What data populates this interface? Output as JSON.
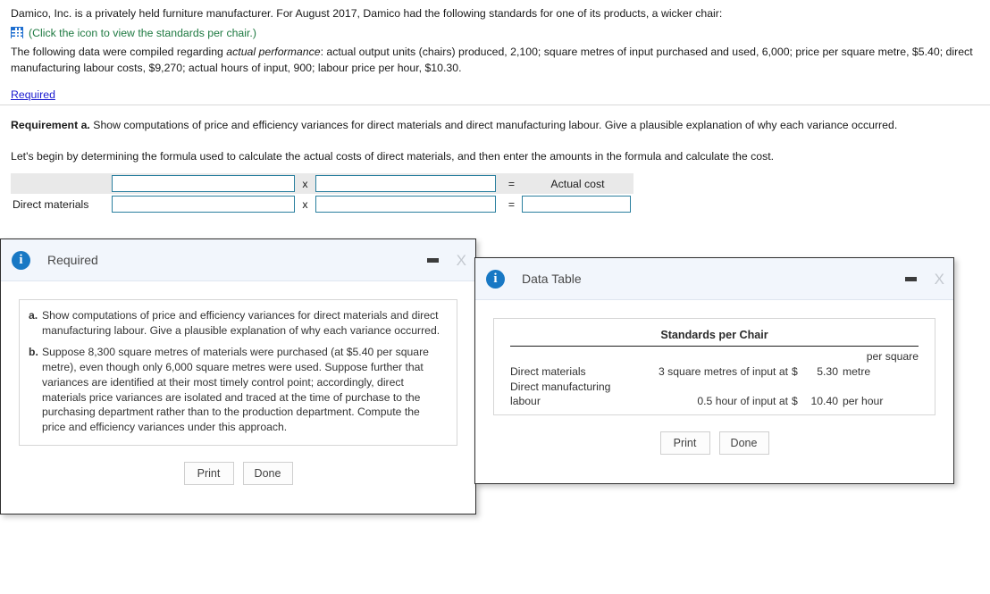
{
  "problem": {
    "intro": "Damico, Inc. is a privately held furniture manufacturer. For August 2017, Damico had the following standards for one of its products, a wicker chair:",
    "icon_name": "table-grid-icon",
    "icon_caption": "(Click the icon to view the standards per chair.)",
    "data_line_a": "The following data were compiled regarding ",
    "data_line_italic": "actual performance",
    "data_line_b": ": actual output units (chairs) produced, 2,100; square metres of input purchased and used, 6,000; price per square metre, $5.40; direct manufacturing labour costs, $9,270; actual hours of input, 900; labour price per hour, $10.30.",
    "required_link": "Required"
  },
  "requirement": {
    "label": "Requirement a.",
    "text": " Show computations of price and efficiency variances for direct materials and direct manufacturing labour. Give a plausible explanation of why each variance occurred.",
    "instruction": "Let's begin by determining the formula used to calculate the actual costs of direct materials, and then enter the amounts in the formula and calculate the cost."
  },
  "formula_table": {
    "header": {
      "label": "",
      "operator_multiply": "x",
      "operator_equals": "=",
      "result_label": "Actual cost"
    },
    "row": {
      "label": "Direct materials",
      "operator_multiply": "x",
      "operator_equals": "=",
      "input1_value": "",
      "input2_value": "",
      "result_value": ""
    }
  },
  "required_dialog": {
    "title": "Required",
    "minimize_label": "Minimize",
    "close_label": "X",
    "items": [
      {
        "marker": "a.",
        "text": "Show computations of price and efficiency variances for direct materials and direct manufacturing labour. Give a plausible explanation of why each variance occurred."
      },
      {
        "marker": "b.",
        "text": "Suppose 8,300 square metres of materials were purchased (at $5.40 per square metre), even though only 6,000 square metres were used. Suppose further that variances are identified at their most timely control point; accordingly, direct materials price variances are isolated and traced at the time of purchase to the purchasing department rather than to the production department. Compute the price and efficiency variances under this approach."
      }
    ],
    "print_label": "Print",
    "done_label": "Done"
  },
  "data_table_dialog": {
    "title": "Data Table",
    "minimize_label": "Minimize",
    "close_label": "X",
    "table_title": "Standards per Chair",
    "rows": [
      {
        "name": "Direct materials",
        "name_line2": "",
        "quantity": "3 square metres of input at",
        "currency": "$",
        "amount": "5.30",
        "unit": "per square metre",
        "unit_line1": "per square",
        "unit_line2": "metre"
      },
      {
        "name": "Direct manufacturing",
        "name_line2": "labour",
        "quantity": "0.5 hour of input at",
        "currency": "$",
        "amount": "10.40",
        "unit": "per hour",
        "unit_line1": "",
        "unit_line2": "per hour"
      }
    ],
    "print_label": "Print",
    "done_label": "Done"
  },
  "colors": {
    "link": "#1a1ad0",
    "icon_caption": "#1f7a42",
    "icon_blue": "#1f6fd0",
    "field_border": "#2a7f9e",
    "dialog_header_bg": "#f2f6fc",
    "info_icon_bg": "#1878c4"
  }
}
